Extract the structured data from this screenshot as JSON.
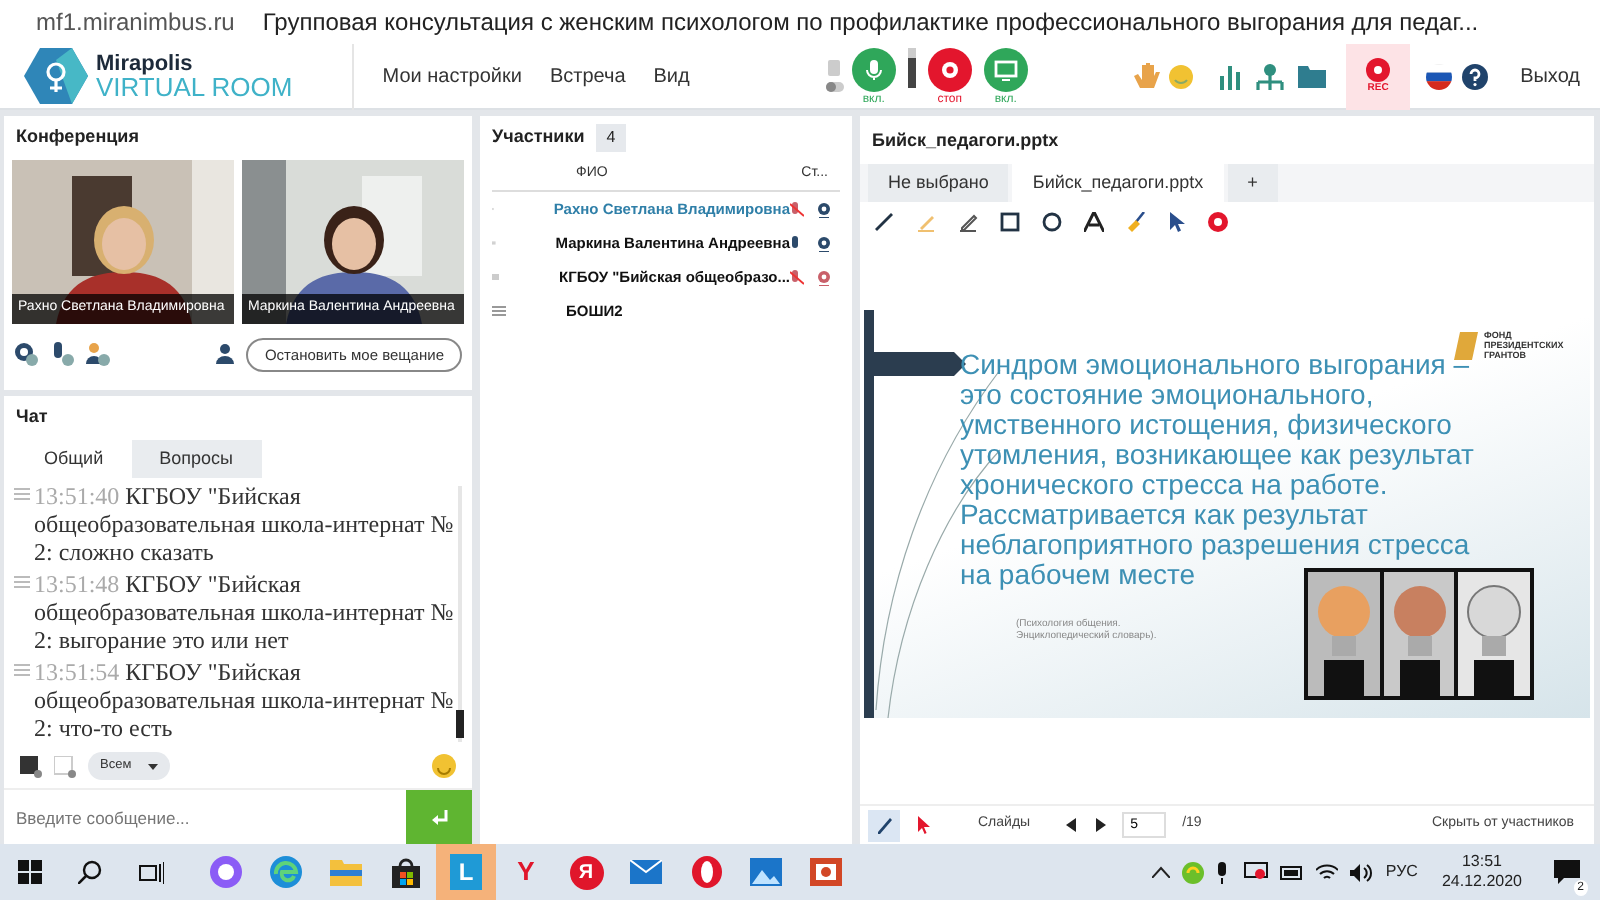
{
  "browser": {
    "url": "mf1.miranimbus.ru",
    "title": "Групповая консультация с женским психологом по профилактике профессионального выгорания для педаг..."
  },
  "app": {
    "logo_top": "Mirapolis",
    "logo_bottom": "VIRTUAL ROOM",
    "menu": [
      "Мои настройки",
      "Встреча",
      "Вид"
    ],
    "media_buttons": [
      {
        "kind": "mic",
        "label": "вкл.",
        "on": true
      },
      {
        "kind": "camera",
        "label": "стоп",
        "on": false
      },
      {
        "kind": "screen",
        "label": "вкл.",
        "on": true
      }
    ],
    "volume": {
      "level": 0.75
    },
    "rec": "REC",
    "exit": "Выход"
  },
  "conference": {
    "title": "Конференция",
    "videos": [
      {
        "name": "Рахно Светлана  Владимировна"
      },
      {
        "name": "Маркина Валентина  Андреевна"
      }
    ],
    "stop_button": "Остановить мое вещание"
  },
  "chat": {
    "title": "Чат",
    "tabs": [
      {
        "label": "Общий",
        "selected": true
      },
      {
        "label": "Вопросы",
        "selected": false
      }
    ],
    "messages": [
      {
        "time": "13:51:40",
        "text": "КГБОУ \"Бийская общеобразовательная школа-интернат № 2: сложно сказать"
      },
      {
        "time": "13:51:48",
        "text": "КГБОУ \"Бийская общеобразовательная школа-интернат № 2: выгорание это или нет"
      },
      {
        "time": "13:51:54",
        "text": "КГБОУ \"Бийская общеобразовательная школа-интернат № 2: что-то есть"
      }
    ],
    "recipient": "Всем",
    "placeholder": "Введите сообщение..."
  },
  "participants": {
    "title": "Участники",
    "count": "4",
    "columns": [
      "ФИО",
      "Ст..."
    ],
    "rows": [
      {
        "kind": "media",
        "name": "Рахно Светлана  Владимировна",
        "current": true,
        "mic_on": false,
        "cam_on": true
      },
      {
        "kind": "media",
        "name": "Маркина Валентина  Андреевна",
        "current": false,
        "mic_on": true,
        "cam_on": true
      },
      {
        "kind": "media",
        "name": "КГБОУ \"Бийская общеобразо...",
        "current": false,
        "mic_on": false,
        "cam_on": false
      },
      {
        "kind": "plain",
        "name": "БОШИ2",
        "current": false
      }
    ]
  },
  "presentation": {
    "title": "Бийск_педагоги.pptx",
    "tabs": [
      {
        "label": "Не выбрано",
        "selected": false
      },
      {
        "label": "Бийск_педагоги.pptx",
        "selected": true
      },
      {
        "label": "+",
        "selected": false
      }
    ],
    "slide": {
      "logo": "ФОНД ПРЕЗИДЕНТСКИХ ГРАНТОВ",
      "text": "Синдром эмоционального выгорания – это состояние эмоционального, умственного истощения, физического утомления, возникающее как результат хронического стресса на работе. Рассматривается как результат неблагоприятного разрешения стресса на рабочем месте",
      "source": "(Психология общения. Энциклопедический словарь)."
    },
    "slides_label": "Слайды",
    "page": "5",
    "total": "/19",
    "hide": "Скрыть от участников"
  },
  "taskbar": {
    "apps": [
      {
        "label": "L",
        "selected": true
      },
      {
        "label": "Y",
        "selected": false
      },
      {
        "label": "Я",
        "selected": false
      }
    ],
    "language": "РУС",
    "time": "13:51",
    "date": "24.12.2020",
    "notifications": "2"
  }
}
